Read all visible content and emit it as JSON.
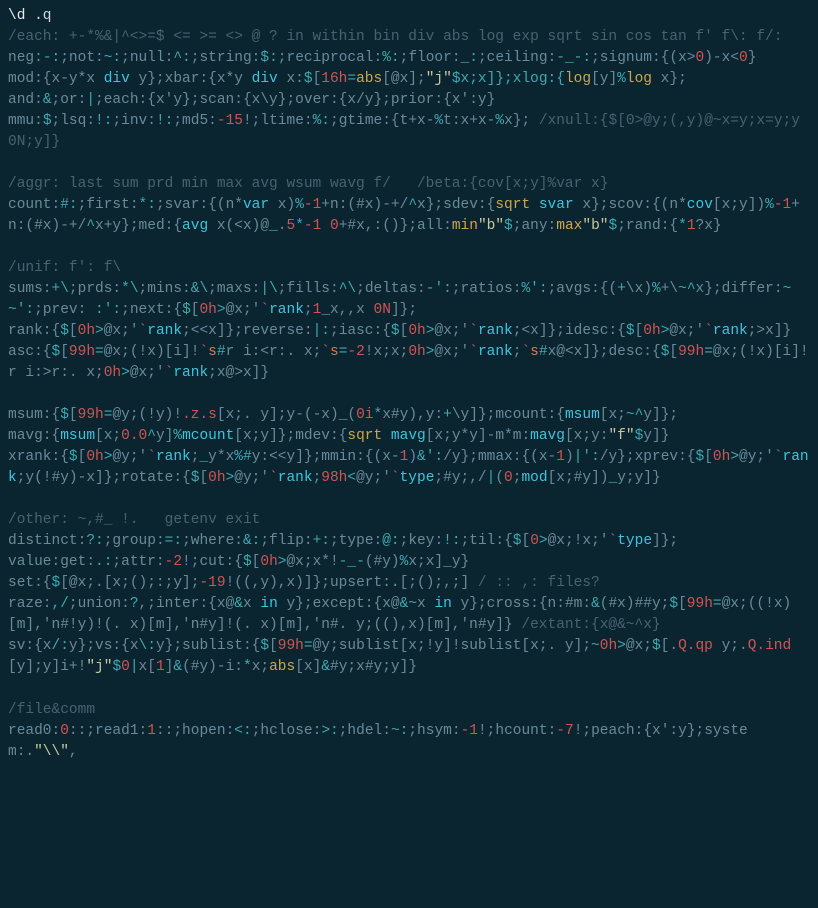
{
  "prompt": {
    "bsd": "\\d",
    "cmd": " .q"
  },
  "each_comment": "/each: +-*%&|^<>=$ <= >= <> @ ? in within bin div abs log exp sqrt sin cos tan f' f\\: f/:",
  "neg": {
    "l1": "neg:",
    "op1": "-:",
    "l2": ";not:",
    "op2": "~:",
    "l3": ";null:",
    "op3": "^:",
    "l4": ";string:",
    "op4": "$:",
    "l5": ";reciprocal:",
    "op5": "%:",
    "l6": ";floor:",
    "op6": "_:",
    "l7": ";ceiling:",
    "op7": "-_-:",
    "l8": ";signum:{(x>",
    "z": "0",
    "l9": ")-x<",
    "z2": "0",
    "l10": "}"
  },
  "mod": {
    "a": "mod:{x-y*x ",
    "div1": "div",
    "b": " y};xbar:{x*y ",
    "div2": "div",
    "c": " x:",
    "d1": "$",
    "d2": "[",
    "n16": "16h",
    "eq": "=",
    "abs": "abs",
    "d3": "[@x];",
    "j": "\"j\"",
    "d4": "$x;x]};xlog:{",
    "log": "log",
    "d5": "[y]",
    "pct": "%",
    "log2": "log",
    "d6": " x};"
  },
  "andor": {
    "a": "and:",
    "amp": "&",
    "b": ";or:",
    "pipe": "|",
    "c": ";each:{x'y};scan:{x\\y};over:{x/y};prior:{x':y}"
  },
  "mmu": {
    "a": "mmu:",
    "d": "$",
    "b": ";lsq:",
    "bang": "!:",
    "c": ";inv:",
    "bang2": "!:",
    "d2": ";md5:",
    "n15": "-15",
    "e": "!;ltime:",
    "pct": "%:",
    "f": ";gtime:{t+x-",
    "pct2": "%",
    "g": "t:x+x-",
    "pct3": "%",
    "h": "x}; ",
    "comment": "/xnull:{$[0>@y;(,y)@~x=y;x=y;y 0N;y]}"
  },
  "aggr_comment": "/aggr: last sum prd min max avg wsum wavg f/   /beta:{cov[x;y]%var x}",
  "count": {
    "a": "count:",
    "h": "#:",
    "b": ";first:",
    "s": "*:",
    "c": ";svar:{(n*",
    "var": "var",
    "d": " x)",
    "pct": "%",
    "n1": "-1",
    "e": "+n:(#x)-+/",
    "car": "^",
    "f": "x};sdev:{",
    "sqrt": "sqrt",
    "g": " ",
    "svar": "svar",
    "h2": " x};scov:{(n*",
    "cov": "cov",
    "i": "[x;y])",
    "pct2": "%",
    "n1b": "-1",
    "j": "+n:(#x)-+/",
    "car2": "^",
    "k": "x+y};med:{",
    "avg": "avg",
    "l": " x(<x)@",
    "u": "_",
    "m": ".",
    "five": "5",
    "st": "*",
    "n1c": "-1",
    "n": " ",
    "z": "0",
    "o": "+#x,:()};all:",
    "min": "min",
    "b1": "\"b\"",
    "d2": "$",
    "p": ";any:",
    "max": "max",
    "b2": "\"b\"",
    "d3": "$",
    "q": ";rand:{",
    "st2": "*",
    "one": "1",
    "r": "?x}"
  },
  "unif_comment": "/unif: f': f\\",
  "sums": {
    "a": "sums:",
    "p": "+\\",
    "b": ";prds:",
    "s": "*\\",
    "c": ";mins:",
    "amp": "&\\",
    "d": ";maxs:",
    "pipe": "|\\",
    "e": ";fills:",
    "car": "^\\",
    "f": ";deltas:",
    "m": "-':",
    "g": ";ratios:",
    "pct": "%':",
    "h": ";avgs:{(",
    "pl": "+",
    "i": "\\x)",
    "pct2": "%",
    "j": "+\\",
    "til": "~",
    "car2": "^",
    "k": "x};differ:",
    "ne": "~~':",
    "l": ";prev: ",
    "sp": ":':",
    "m2": ";next:{",
    "d1": "$",
    "n": "[",
    "z": "0h",
    "gt": ">",
    "o": "@x;'",
    "bt": "`",
    "rank": "rank",
    "p2": ";",
    "one": "1",
    "u": "_",
    "q": "x,,x ",
    "zn": "0N",
    "r": "]};"
  },
  "rank": {
    "a": "rank:{",
    "d": "$",
    "b": "[",
    "z": "0h",
    "gt": ">",
    "c": "@x;'",
    "bt": "`",
    "rnk": "rank",
    "d2": ";<<x]};reverse:",
    "pipe": "|:",
    "e": ";iasc:{",
    "d3": "$",
    "f": "[",
    "z2": "0h",
    "gt2": ">",
    "g": "@x;'",
    "bt2": "`",
    "rnk2": "rank",
    "h": ";<x]};idesc:{",
    "d4": "$",
    "i": "[",
    "z3": "0h",
    "gt3": ">",
    "j": "@x;'",
    "bt3": "`",
    "rnk3": "rank",
    "k": ";>x]}"
  },
  "asc": {
    "a": "asc:{",
    "d": "$",
    "b": "[",
    "n99": "99h",
    "eq": "=",
    "c": "@x;(!x)[i]!",
    "bt": "`",
    "s": "s",
    "h": "#",
    "d2": "r i:<r:. x;",
    "bt2": "`",
    "s2": "s",
    "eq2": "=",
    "n2": "-2",
    "e": "!x;x;",
    "z": "0h",
    "gt": ">",
    "f": "@x;'",
    "bt3": "`",
    "rnk": "rank",
    "g": ";",
    "bt4": "`",
    "s3": "s",
    "h2": "#",
    "i": "x@<x]};desc:{",
    "d3": "$",
    "j": "[",
    "n99b": "99h",
    "eq3": "=",
    "k": "@x;(!x)[i]!r i:>r:. x;",
    "z2": "0h",
    "gt2": ">",
    "l": "@x;'",
    "bt5": "`",
    "rnk2": "rank",
    "m": ";x@>x]}"
  },
  "msum": {
    "a": "msum:{",
    "d": "$",
    "b": "[",
    "n99": "99h",
    "eq": "=",
    "c": "@y;(!y)!",
    "zs": ".z.s",
    "d2": "[x;. y];y-(-x)",
    "u": "_",
    "e": "(",
    "z": "0i",
    "st": "*",
    "f": "x#y),y:",
    "pl": "+",
    "g": "\\y]};mcount:{",
    "msum": "msum",
    "h": "[x;",
    "til": "~",
    "car": "^",
    "i": "y]};"
  },
  "mavg": {
    "a": "mavg:{",
    "msum": "msum",
    "b": "[x;",
    "z": "0.0",
    "car": "^",
    "c": "y]",
    "pct": "%",
    "mc": "mcount",
    "d": "[x;y]};mdev:{",
    "sqrt": "sqrt",
    "e": " ",
    "mavg2": "mavg",
    "f": "[x;y*y]-m*m:",
    "mavg3": "mavg",
    "g": "[x;y:",
    "fstr": "\"f\"",
    "d2": "$",
    "h": "y]}"
  },
  "xrank": {
    "a": "xrank:{",
    "d": "$",
    "b": "[",
    "z": "0h",
    "gt": ">",
    "c": "@y;'",
    "bt": "`",
    "rnk": "rank",
    "d2": ";",
    "u": "_",
    "e": "y*x",
    "pct": "%",
    "h": "#",
    "f": "y:<<y]};mmin:{(x-",
    "one": "1",
    "g": ")",
    "amp": "&",
    "sq": "':",
    "i": "/y};mmax:{(x-",
    "one2": "1",
    "j": ")",
    "pipe": "|",
    "sq2": "':",
    "k": "/y};xprev:{",
    "d3": "$",
    "l": "[",
    "z2": "0h",
    "gt2": ">",
    "m": "@y;'",
    "bt2": "`",
    "rnk2": "rank",
    "n": ";y(!#y)-x]};rotate:{",
    "d4": "$",
    "o": "[",
    "z3": "0h",
    "gt3": ">",
    "p": "@y;'",
    "bt3": "`",
    "rnk3": "rank",
    "q": ";",
    "n98": "98h",
    "lt": "<",
    "r": "@y;'",
    "bt4": "`",
    "typ": "type",
    "s": ";#y;,/",
    "pipe2": "|",
    "t": "(",
    "zero": "0",
    "u2": ";",
    "mod": "mod",
    "v": "[x;#y])",
    "u3": "_",
    "w": "y;y]}"
  },
  "other_comment": "/other: ~,#_ !.   getenv exit",
  "distinct": {
    "a": "distinct:",
    "q": "?:",
    "b": ";group:",
    "eq": "=:",
    "c": ";where:",
    "amp": "&:",
    "d": ";flip:",
    "pl": "+:",
    "e": ";type:",
    "at": "@:",
    "f": ";key:",
    "bang": "!:",
    "g": ";til:{",
    "d2": "$",
    "h": "[",
    "z": "0",
    "gt": ">",
    "i": "@x;!x;'",
    "bt": "`",
    "typ": "type",
    "j": "]};"
  },
  "valueget": {
    "a": "value:get:",
    "dot": ".:",
    "b": ";attr:",
    "n2": "-2",
    "c": "!;cut:{",
    "d": "$",
    "e": "[",
    "z": "0h",
    "gt": ">",
    "f": "@x;x*!",
    "n1": "-_-",
    "g": "(#y)",
    "pct": "%",
    "h": "x;x]",
    "u": "_",
    "i": "y}"
  },
  "setdef": {
    "a": "set:{",
    "d": "$",
    "b": "[@x;.[x;();:;y];",
    "n19": "-19",
    "c": "!((,y),x)]};upsert:",
    "dot": ".",
    "e": "[;();,;] ",
    "comment": "/ :: ,: files?"
  },
  "raze": {
    "a": "raze:",
    "c": ",/",
    "b": ";union:",
    "q": "?",
    "d": ",;inter:{x@",
    "amp": "&",
    "e": "x ",
    "in": "in",
    "f": " y};except:{x@",
    "amp2": "&",
    "til": "~",
    "g": "x ",
    "in2": "in",
    "h": " y};cross:{n:#m:",
    "amp3": "&",
    "i": "(#x)##y;",
    "d2": "$",
    "j": "[",
    "n99": "99h",
    "eq": "=",
    "k": "@x;((!x)[m],'n#!y)!(. x)[m],'n#y]!(. x)[m],'n#. y;((),x)[m],'n#y]} ",
    "comment": "/extant:{x@&~^x}"
  },
  "sv": {
    "a": "sv:{x",
    "sl": "/:",
    "b": "y};vs:{x",
    "bsl": "\\:",
    "c": "y};sublist:{",
    "d": "$",
    "e": "[",
    "n99": "99h",
    "eq": "=",
    "f": "@y;sublist[x;!y]!sublist[x;. y];",
    "til": "~",
    "z": "0h",
    "gt": ">",
    "g": "@x;",
    "d2": "$",
    "h": "[.",
    "Qqp": "Q.qp",
    "i": " y;.",
    "Qind": "Q.ind",
    "j": "[y];y]i+!",
    "jstr": "\"j\"",
    "d3": "$",
    "z2": "0",
    "pipe": "|",
    "k": "x[",
    "one": "1",
    "l": "]",
    "amp": "&",
    "m": "(#y)-i:",
    "st": "*",
    "n": "x;",
    "abs": "abs",
    "o": "[x]",
    "amp2": "&",
    "p": "#y;x#y;y]}"
  },
  "filecomm": "/file&comm",
  "read0": {
    "a": "read0:",
    "z": "0",
    "c": "::;read1:",
    "one": "1",
    "d": "::;hopen:",
    "lt": "<:",
    "e": ";hclose:",
    "gt": ">:",
    "f": ";hdel:",
    "til": "~:",
    "g": ";hsym:",
    "n1": "-1",
    "h": "!;hcount:",
    "n7": "-7",
    "i": "!;peach:{x':y};system:.",
    "bs": "\"\\\\\"",
    "j": ","
  }
}
